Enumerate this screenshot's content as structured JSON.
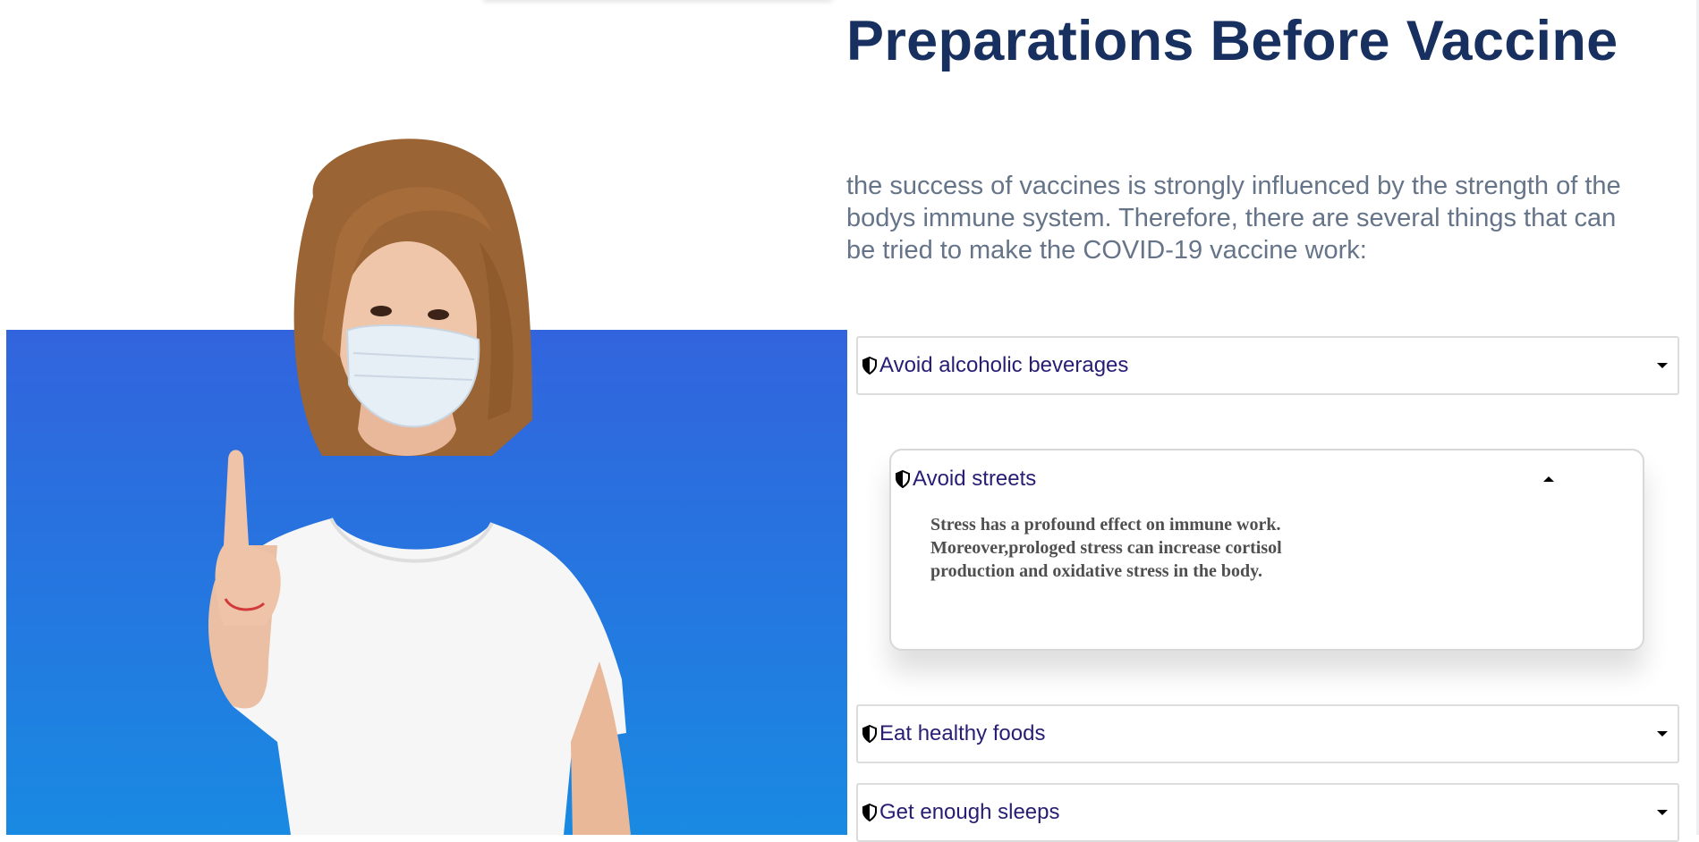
{
  "page": {
    "title": "Preparations Before Vaccine",
    "intro": "the success of vaccines is strongly influenced by the strength of the bodys immune system. Therefore, there are several things that can be tried to make the COVID-19 vaccine work:"
  },
  "colors": {
    "title": "#17305f",
    "intro": "#657488",
    "item_label": "#271d74",
    "hero_top": "#3264dd",
    "hero_bottom": "#198ae2"
  },
  "hero": {
    "image": "woman-with-face-mask-raising-index-finger"
  },
  "accordion": {
    "items": [
      {
        "label": "Avoid alcoholic beverages",
        "icon": "shield-icon",
        "expanded": false
      },
      {
        "label": "Avoid streets",
        "icon": "shield-icon",
        "expanded": true,
        "body": "Stress has a profound effect on immune work. Moreover,prologed stress can increase cortisol production and oxidative stress in the body."
      },
      {
        "label": "Eat healthy foods",
        "icon": "shield-icon",
        "expanded": false
      },
      {
        "label": "Get enough sleeps",
        "icon": "shield-icon",
        "expanded": false
      }
    ]
  }
}
